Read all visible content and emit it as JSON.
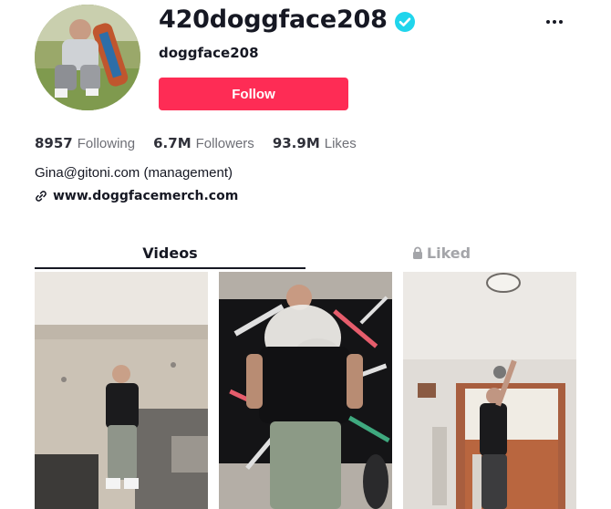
{
  "profile": {
    "username": "420doggface208",
    "nickname": "doggface208",
    "follow_label": "Follow",
    "verified_icon": "verified-badge-icon",
    "accent": "#fe2c55",
    "verified_color": "#20d5ec"
  },
  "stats": {
    "following_count": "8957",
    "following_label": "Following",
    "followers_count": "6.7M",
    "followers_label": "Followers",
    "likes_count": "93.9M",
    "likes_label": "Likes"
  },
  "bio": {
    "text": "Gina@gitoni.com (management)",
    "link": "www.doggfacemerch.com"
  },
  "tabs": [
    {
      "label": "Videos",
      "active": true
    },
    {
      "label": "Liked",
      "locked": true
    }
  ],
  "videos": [
    {
      "name": "video-thumbnail-1"
    },
    {
      "name": "video-thumbnail-2"
    },
    {
      "name": "video-thumbnail-3"
    }
  ]
}
